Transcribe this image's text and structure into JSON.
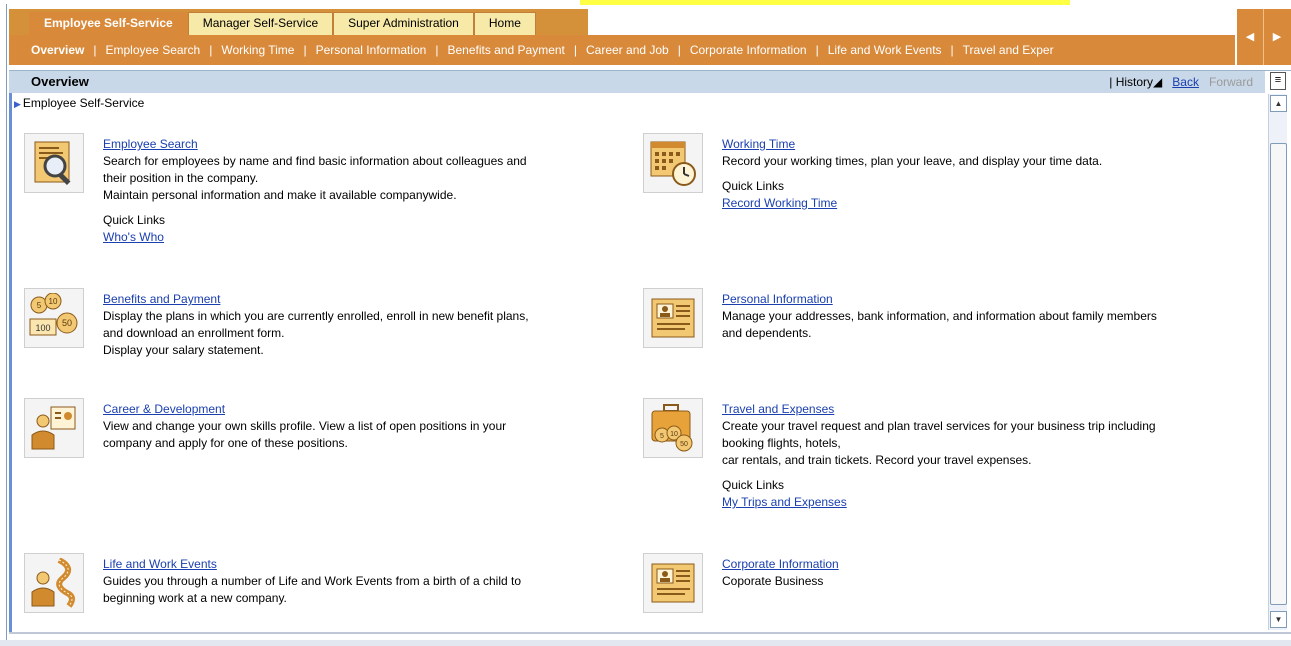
{
  "tabs": [
    {
      "label": "Employee Self-Service",
      "active": true
    },
    {
      "label": "Manager Self-Service",
      "active": false
    },
    {
      "label": "Super Administration",
      "active": false
    },
    {
      "label": "Home",
      "active": false
    }
  ],
  "subnav": [
    "Overview",
    "Employee Search",
    "Working Time",
    "Personal Information",
    "Benefits and Payment",
    "Career and Job",
    "Corporate Information",
    "Life and Work Events",
    "Travel and Exper"
  ],
  "overview": {
    "title": "Overview",
    "history": "History",
    "back": "Back",
    "forward": "Forward"
  },
  "breadcrumb": "Employee Self-Service",
  "cards": {
    "employee_search": {
      "title": "Employee Search",
      "desc": "Search for employees by name and find basic information about colleagues and\ntheir position in the company.\nMaintain personal information and make it available companywide.",
      "quick_links_label": "Quick Links",
      "quick_link": "Who's Who"
    },
    "working_time": {
      "title": "Working Time",
      "desc": "Record your working times, plan your leave, and display your time data.",
      "quick_links_label": "Quick Links",
      "quick_link": "Record Working Time"
    },
    "benefits": {
      "title": "Benefits and Payment",
      "desc": "Display the plans in which you are currently enrolled, enroll in new benefit plans,\nand download an enrollment form.\nDisplay your salary statement."
    },
    "personal": {
      "title": "Personal Information",
      "desc": "Manage your addresses, bank information, and information about family members\nand dependents."
    },
    "career": {
      "title": "Career & Development",
      "desc": "View and change your own skills profile. View a list of open positions in your\ncompany and apply for one of these positions."
    },
    "travel": {
      "title": "Travel and Expenses",
      "desc": "Create your travel request and plan travel services for your business trip including\nbooking flights, hotels,\ncar rentals, and train tickets. Record your travel expenses.",
      "quick_links_label": "Quick Links",
      "quick_link": "My Trips and Expenses"
    },
    "life": {
      "title": "Life and Work Events",
      "desc": "Guides you through a number of Life and Work Events from a birth of a child to\nbeginning work at a new company."
    },
    "corporate": {
      "title": "Corporate Information",
      "desc": "Coporate Business"
    }
  },
  "icons": {
    "employee_search": "magnifier-document-icon",
    "working_time": "calendar-clock-icon",
    "benefits": "coins-icon",
    "personal": "id-card-icon",
    "career": "person-certificate-icon",
    "travel": "suitcase-icon",
    "life": "person-path-icon",
    "corporate": "id-card-icon"
  },
  "colors": {
    "tab_active": "#d8893a",
    "tab_inactive": "#f7e9a8",
    "link": "#1a3fae",
    "overview_bar": "#c9d8e8"
  }
}
